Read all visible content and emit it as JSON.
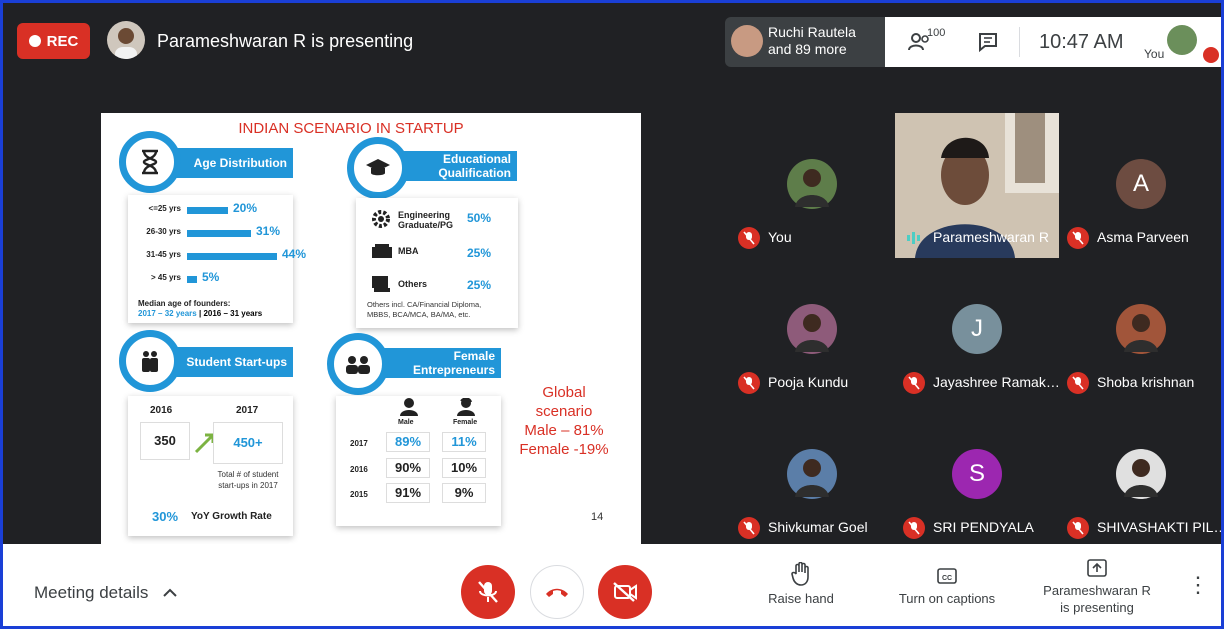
{
  "top_bar": {
    "rec_label": "REC",
    "presenting_title": "Parameshwaran R is presenting",
    "participants_chip": {
      "line1": "Ruchi Rautela",
      "line2": "and 89 more"
    },
    "people_count": "100",
    "clock": "10:47 AM",
    "you_label": "You"
  },
  "slide": {
    "title": "INDIAN SCENARIO IN STARTUP",
    "age": {
      "heading": "Age Distribution",
      "rows": [
        {
          "label": "<=25 yrs",
          "value": "20%",
          "fraction": 0.2
        },
        {
          "label": "26-30 yrs",
          "value": "31%",
          "fraction": 0.31
        },
        {
          "label": "31-45 yrs",
          "value": "44%",
          "fraction": 0.44
        },
        {
          "label": "> 45 yrs",
          "value": "5%",
          "fraction": 0.05
        }
      ],
      "median_label": "Median age of founders:",
      "median_a": "2017 – 32 years",
      "median_sep": "|",
      "median_b": "2016 – 31 years"
    },
    "education": {
      "heading_line1": "Educational",
      "heading_line2": "Qualification",
      "rows": [
        {
          "label_line1": "Engineering",
          "label_line2": "Graduate/PG",
          "value": "50%"
        },
        {
          "label_line1": "MBA",
          "label_line2": "",
          "value": "25%"
        },
        {
          "label_line1": "Others",
          "label_line2": "",
          "value": "25%"
        }
      ],
      "note_line1": "Others incl. CA/Financial Diploma,",
      "note_line2": "MBBS, BCA/MCA, BA/MA, etc."
    },
    "student": {
      "heading": "Student Start-ups",
      "year_a": "2016",
      "year_b": "2017",
      "value_a": "350",
      "value_b": "450+",
      "caption_line1": "Total # of student",
      "caption_line2": "start-ups in 2017",
      "growth_value": "30%",
      "growth_label": "YoY Growth Rate"
    },
    "female": {
      "heading_line1": "Female",
      "heading_line2": "Entrepreneurs",
      "col_male": "Male",
      "col_female": "Female",
      "rows": [
        {
          "year": "2017",
          "male": "89%",
          "female": "11%"
        },
        {
          "year": "2016",
          "male": "90%",
          "female": "10%"
        },
        {
          "year": "2015",
          "male": "91%",
          "female": "9%"
        }
      ]
    },
    "global": {
      "line1": "Global",
      "line2": "scenario",
      "line3": "Male – 81%",
      "line4": "Female -19%"
    },
    "page_number": "14"
  },
  "participants": [
    {
      "name": "You",
      "initial": "",
      "color": "#5e7d4a"
    },
    {
      "name": "Parameshwaran R",
      "initial": "",
      "color": "#b7a99a"
    },
    {
      "name": "Asma Parveen",
      "initial": "A",
      "color": "#6d4c41"
    },
    {
      "name": "Pooja Kundu",
      "initial": "",
      "color": "#8e5b7a"
    },
    {
      "name": "Jayashree Ramak…",
      "initial": "J",
      "color": "#78909c"
    },
    {
      "name": "Shoba krishnan",
      "initial": "",
      "color": "#a1553a"
    },
    {
      "name": "Shivkumar Goel",
      "initial": "",
      "color": "#5b7ea8"
    },
    {
      "name": "SRI PENDYALA",
      "initial": "S",
      "color": "#9c27b0"
    },
    {
      "name": "SHIVASHAKTI PIL…",
      "initial": "",
      "color": "#e0e0e0"
    }
  ],
  "bottom_bar": {
    "meeting_details": "Meeting details",
    "raise_hand": "Raise hand",
    "captions": "Turn on captions",
    "presenting_line1": "Parameshwaran R",
    "presenting_line2": "is presenting"
  },
  "colors": {
    "accent_blue": "#2196d8",
    "danger_red": "#d93025",
    "frame_blue": "#1a3fd6",
    "dark_bg": "#202124"
  }
}
